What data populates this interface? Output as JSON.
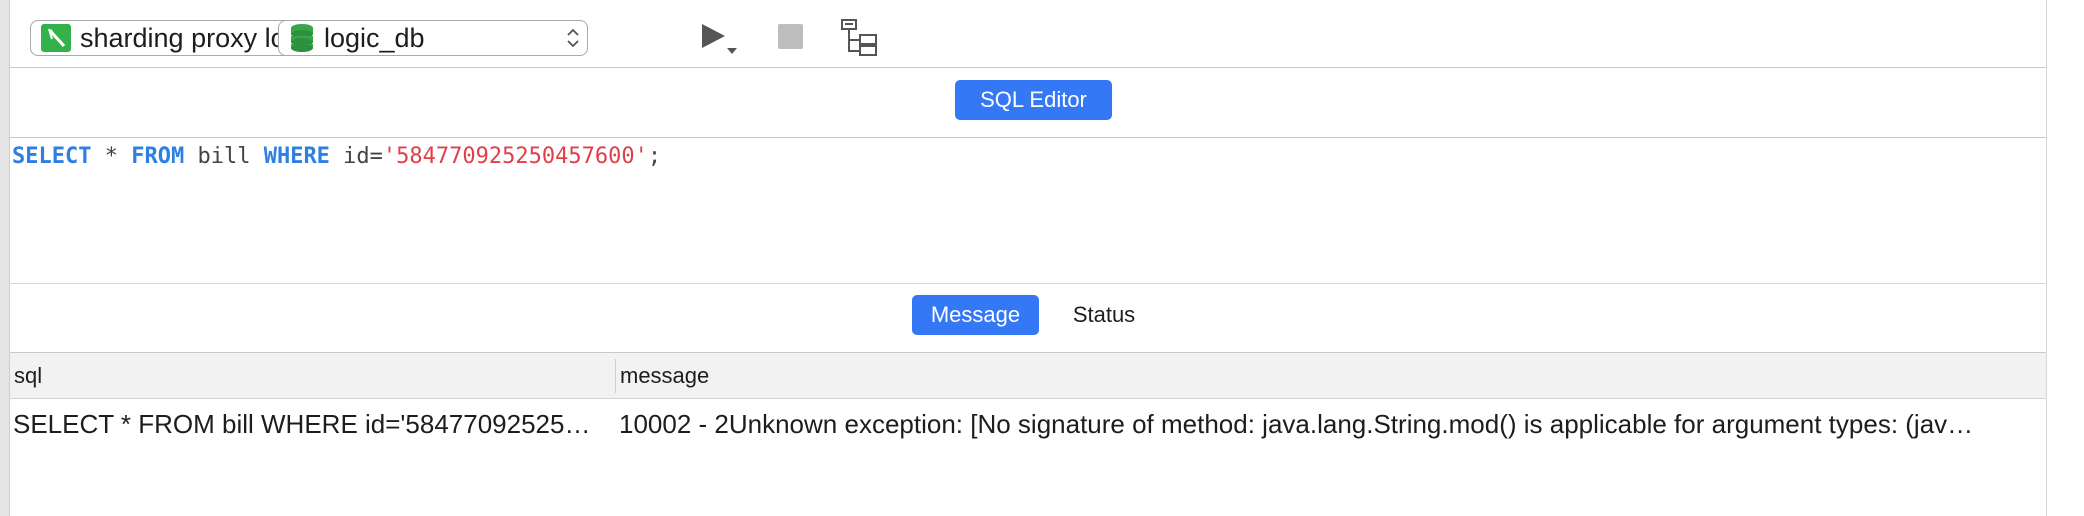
{
  "toolbar": {
    "connection": {
      "label": "sharding proxy logic",
      "icon": "connection-icon"
    },
    "database": {
      "label": "logic_db",
      "icon": "database-icon"
    },
    "run_icon": "play-icon",
    "stop_icon": "stop-icon",
    "plan_icon": "explain-plan-icon"
  },
  "editor_bar": {
    "sql_editor_label": "SQL Editor"
  },
  "editor": {
    "tokens": [
      {
        "text": "SELECT",
        "kind": "kw"
      },
      {
        "text": " * ",
        "kind": "plain"
      },
      {
        "text": "FROM",
        "kind": "kw"
      },
      {
        "text": " bill ",
        "kind": "plain"
      },
      {
        "text": "WHERE",
        "kind": "kw"
      },
      {
        "text": " id=",
        "kind": "plain"
      },
      {
        "text": "'584770925250457600'",
        "kind": "str"
      },
      {
        "text": ";",
        "kind": "plain"
      }
    ]
  },
  "result_tabs": {
    "message_label": "Message",
    "status_label": "Status"
  },
  "grid": {
    "columns": [
      "sql",
      "message"
    ],
    "rows": [
      {
        "sql": "SELECT * FROM bill WHERE id='58477092525…",
        "message": "10002 - 2Unknown exception: [No signature of method: java.lang.String.mod() is applicable for argument types: (jav…"
      }
    ]
  },
  "colors": {
    "accent": "#3478f6",
    "keyword": "#2f7fe3",
    "string": "#e0404a",
    "connection_icon": "#33b24b"
  }
}
